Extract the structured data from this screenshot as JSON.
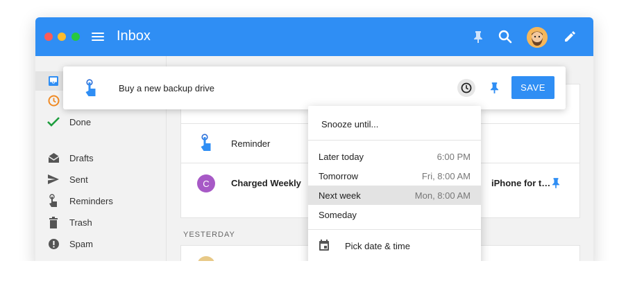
{
  "window": {
    "title": "Inbox"
  },
  "icons": {
    "menu": "hamburger-menu-icon",
    "pin": "pin-icon",
    "search": "search-icon",
    "compose": "pencil-icon",
    "snooze": "clock-icon"
  },
  "colors": {
    "accent": "#2f8ef4",
    "done_check": "#1e9e3e",
    "snoozed_clock": "#f08a24",
    "avatar_c": "#a759c6"
  },
  "sidebar": {
    "items": [
      {
        "label": "Inbox",
        "icon": "inbox-icon"
      },
      {
        "label": "Snoozed",
        "icon": "clock-icon"
      },
      {
        "label": "Done",
        "icon": "check-icon"
      },
      {
        "label": "Drafts",
        "icon": "drafts-icon"
      },
      {
        "label": "Sent",
        "icon": "send-icon"
      },
      {
        "label": "Reminders",
        "icon": "reminder-hand-icon"
      },
      {
        "label": "Trash",
        "icon": "trash-icon"
      },
      {
        "label": "Spam",
        "icon": "spam-icon"
      }
    ]
  },
  "composer": {
    "text": "Buy a new backup drive",
    "save_label": "SAVE"
  },
  "list": {
    "rows": [
      {
        "label": "Reminder"
      },
      {
        "sender": "Charged Weekly",
        "avatar_letter": "C",
        "subject_fragment": "iPhone for t…"
      }
    ],
    "section_label": "YESTERDAY"
  },
  "snooze_menu": {
    "header": "Snooze until...",
    "options": [
      {
        "label": "Later today",
        "time": "6:00 PM"
      },
      {
        "label": "Tomorrow",
        "time": "Fri, 8:00 AM"
      },
      {
        "label": "Next week",
        "time": "Mon, 8:00 AM"
      },
      {
        "label": "Someday",
        "time": ""
      }
    ],
    "selected": "Next week",
    "pick_label": "Pick date & time"
  }
}
